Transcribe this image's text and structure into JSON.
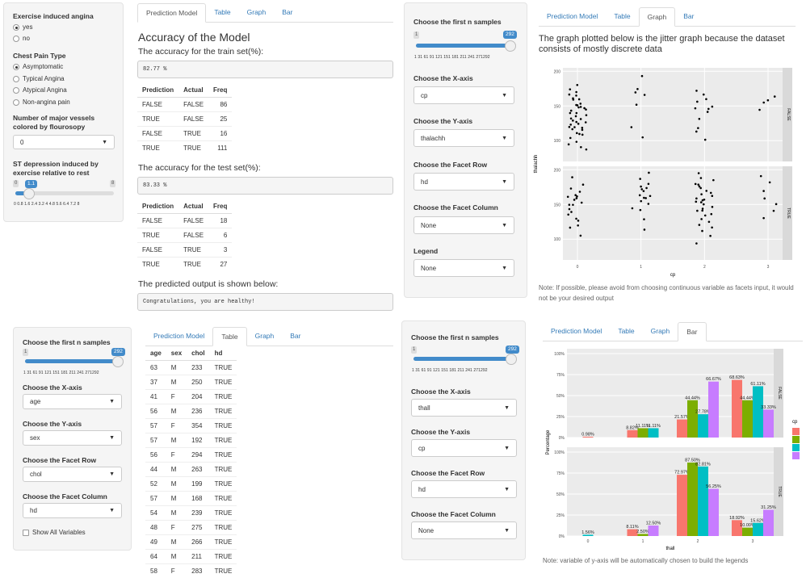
{
  "panel_a": {
    "angina": {
      "label": "Exercise induced angina",
      "options": [
        "yes",
        "no"
      ],
      "selected": "yes"
    },
    "cp": {
      "label": "Chest Pain Type",
      "options": [
        "Asymptomatic",
        "Typical Angina",
        "Atypical Angina",
        "Non-angina pain"
      ],
      "selected": "Asymptomatic"
    },
    "vessels": {
      "label": "Number of major vessels colored by flourosopy",
      "value": "0"
    },
    "st": {
      "label": "ST depression induced by exercise relative to rest",
      "min": "0",
      "max": "8",
      "value": "1.1",
      "value_num": 1.1,
      "ticks": "0  0.8  1.6  2.4  3.2   4   4.8  5.6  6.4  7.2   8"
    }
  },
  "tabs": [
    "Prediction Model",
    "Table",
    "Graph",
    "Bar"
  ],
  "prediction": {
    "title": "Accuracy of the Model",
    "train_label": "The accuracy for the train set(%):",
    "train_value": "82.77 %",
    "test_label": "The accuracy for the test set(%):",
    "test_value": "83.33 %",
    "headers": [
      "Prediction",
      "Actual",
      "Freq"
    ],
    "train_rows": [
      [
        "FALSE",
        "FALSE",
        "86"
      ],
      [
        "TRUE",
        "FALSE",
        "25"
      ],
      [
        "FALSE",
        "TRUE",
        "16"
      ],
      [
        "TRUE",
        "TRUE",
        "111"
      ]
    ],
    "test_rows": [
      [
        "FALSE",
        "FALSE",
        "18"
      ],
      [
        "TRUE",
        "FALSE",
        "6"
      ],
      [
        "FALSE",
        "TRUE",
        "3"
      ],
      [
        "TRUE",
        "TRUE",
        "27"
      ]
    ],
    "output_label": "The predicted output is shown below:",
    "output_value": "Congratulations, you are healthy!"
  },
  "controls_graph": {
    "samples_label": "Choose the first n samples",
    "samples_min": "1",
    "samples_max": "292",
    "samples_value": "292",
    "ticks": "1  31  61  91  121 151 181 211 241 271292",
    "x_label": "Choose the X-axis",
    "x_value": "cp",
    "y_label": "Choose the Y-axis",
    "y_value": "thalachh",
    "row_label": "Choose the Facet Row",
    "row_value": "hd",
    "col_label": "Choose the Facet Column",
    "col_value": "None",
    "legend_label": "Legend",
    "legend_value": "None"
  },
  "graph": {
    "title": "The graph plotted below is the jitter graph because the dataset consists of mostly discrete data",
    "note": "Note: If possible, please avoid from choosing continuous variable as facets input, it would not be your desired output",
    "chart_data": {
      "type": "scatter",
      "xlabel": "cp",
      "ylabel": "thalachh",
      "facets": [
        "FALSE",
        "TRUE"
      ],
      "x_ticks": [
        "0",
        "1",
        "2",
        "3"
      ],
      "y_ticks": [
        "100",
        "150",
        "200"
      ],
      "ylim": [
        70,
        205
      ],
      "series": [
        {
          "name": "FALSE",
          "points": [
            [
              0,
              180
            ],
            [
              0,
              175
            ],
            [
              0,
              170
            ],
            [
              0,
              165
            ],
            [
              0,
              160
            ],
            [
              0,
              158
            ],
            [
              0,
              155
            ],
            [
              0,
              152
            ],
            [
              0,
              150
            ],
            [
              0,
              148
            ],
            [
              0,
              145
            ],
            [
              0,
              143
            ],
            [
              0,
              140
            ],
            [
              0,
              138
            ],
            [
              0,
              135
            ],
            [
              0,
              132
            ],
            [
              0,
              130
            ],
            [
              0,
              128
            ],
            [
              0,
              125
            ],
            [
              0,
              122
            ],
            [
              0,
              120
            ],
            [
              0,
              118
            ],
            [
              0,
              115
            ],
            [
              0,
              112
            ],
            [
              0,
              110
            ],
            [
              0,
              108
            ],
            [
              0,
              105
            ],
            [
              0,
              100
            ],
            [
              0,
              95
            ],
            [
              0,
              90
            ],
            [
              0,
              88
            ],
            [
              0,
              165
            ],
            [
              0,
              150
            ],
            [
              0,
              140
            ],
            [
              0,
              130
            ],
            [
              0,
              120
            ],
            [
              0,
              160
            ],
            [
              0,
              145
            ],
            [
              0,
              125
            ],
            [
              0,
              115
            ],
            [
              1,
              195
            ],
            [
              1,
              175
            ],
            [
              1,
              170
            ],
            [
              1,
              165
            ],
            [
              1,
              150
            ],
            [
              1,
              120
            ],
            [
              1,
              105
            ],
            [
              2,
              170
            ],
            [
              2,
              165
            ],
            [
              2,
              160
            ],
            [
              2,
              155
            ],
            [
              2,
              150
            ],
            [
              2,
              148
            ],
            [
              2,
              145
            ],
            [
              2,
              140
            ],
            [
              2,
              130
            ],
            [
              2,
              120
            ],
            [
              2,
              115
            ],
            [
              2,
              100
            ],
            [
              3,
              165
            ],
            [
              3,
              160
            ],
            [
              3,
              155
            ],
            [
              3,
              145
            ]
          ]
        },
        {
          "name": "TRUE",
          "points": [
            [
              0,
              190
            ],
            [
              0,
              180
            ],
            [
              0,
              175
            ],
            [
              0,
              170
            ],
            [
              0,
              165
            ],
            [
              0,
              162
            ],
            [
              0,
              160
            ],
            [
              0,
              158
            ],
            [
              0,
              155
            ],
            [
              0,
              152
            ],
            [
              0,
              150
            ],
            [
              0,
              148
            ],
            [
              0,
              145
            ],
            [
              0,
              140
            ],
            [
              0,
              135
            ],
            [
              0,
              130
            ],
            [
              0,
              125
            ],
            [
              0,
              120
            ],
            [
              0,
              115
            ],
            [
              0,
              105
            ],
            [
              1,
              195
            ],
            [
              1,
              185
            ],
            [
              1,
              180
            ],
            [
              1,
              175
            ],
            [
              1,
              172
            ],
            [
              1,
              170
            ],
            [
              1,
              168
            ],
            [
              1,
              165
            ],
            [
              1,
              162
            ],
            [
              1,
              160
            ],
            [
              1,
              158
            ],
            [
              1,
              155
            ],
            [
              1,
              150
            ],
            [
              1,
              145
            ],
            [
              1,
              140
            ],
            [
              1,
              130
            ],
            [
              1,
              115
            ],
            [
              2,
              195
            ],
            [
              2,
              190
            ],
            [
              2,
              185
            ],
            [
              2,
              180
            ],
            [
              2,
              178
            ],
            [
              2,
              175
            ],
            [
              2,
              172
            ],
            [
              2,
              170
            ],
            [
              2,
              168
            ],
            [
              2,
              165
            ],
            [
              2,
              162
            ],
            [
              2,
              160
            ],
            [
              2,
              158
            ],
            [
              2,
              156
            ],
            [
              2,
              155
            ],
            [
              2,
              153
            ],
            [
              2,
              150
            ],
            [
              2,
              148
            ],
            [
              2,
              145
            ],
            [
              2,
              143
            ],
            [
              2,
              140
            ],
            [
              2,
              138
            ],
            [
              2,
              135
            ],
            [
              2,
              130
            ],
            [
              2,
              125
            ],
            [
              2,
              120
            ],
            [
              2,
              115
            ],
            [
              2,
              110
            ],
            [
              2,
              105
            ],
            [
              2,
              95
            ],
            [
              3,
              190
            ],
            [
              3,
              180
            ],
            [
              3,
              170
            ],
            [
              3,
              160
            ],
            [
              3,
              150
            ],
            [
              3,
              140
            ],
            [
              3,
              130
            ]
          ]
        }
      ]
    }
  },
  "controls_table": {
    "samples_label": "Choose the first n samples",
    "samples_value": "292",
    "samples_min": "1",
    "ticks": "1  31  61  91  121 151 181 211 241 271292",
    "x_label": "Choose the X-axis",
    "x_value": "age",
    "y_label": "Choose the Y-axis",
    "y_value": "sex",
    "row_label": "Choose the Facet Row",
    "row_value": "chol",
    "col_label": "Choose the Facet Column",
    "col_value": "hd",
    "checkbox_label": "Show All Variables"
  },
  "table": {
    "headers": [
      "age",
      "sex",
      "chol",
      "hd"
    ],
    "rows": [
      [
        "63",
        "M",
        "233",
        "TRUE"
      ],
      [
        "37",
        "M",
        "250",
        "TRUE"
      ],
      [
        "41",
        "F",
        "204",
        "TRUE"
      ],
      [
        "56",
        "M",
        "236",
        "TRUE"
      ],
      [
        "57",
        "F",
        "354",
        "TRUE"
      ],
      [
        "57",
        "M",
        "192",
        "TRUE"
      ],
      [
        "56",
        "F",
        "294",
        "TRUE"
      ],
      [
        "44",
        "M",
        "263",
        "TRUE"
      ],
      [
        "52",
        "M",
        "199",
        "TRUE"
      ],
      [
        "57",
        "M",
        "168",
        "TRUE"
      ],
      [
        "54",
        "M",
        "239",
        "TRUE"
      ],
      [
        "48",
        "F",
        "275",
        "TRUE"
      ],
      [
        "49",
        "M",
        "266",
        "TRUE"
      ],
      [
        "64",
        "M",
        "211",
        "TRUE"
      ],
      [
        "58",
        "F",
        "283",
        "TRUE"
      ]
    ]
  },
  "controls_bar": {
    "samples_label": "Choose the first n samples",
    "samples_value": "292",
    "samples_min": "1",
    "ticks": "1  31  61  91  121 151 181 211 241 271292",
    "x_label": "Choose the X-axis",
    "x_value": "thall",
    "y_label": "Choose the Y-axis",
    "y_value": "cp",
    "row_label": "Choose the Facet Row",
    "row_value": "hd",
    "col_label": "Choose the Facet Column",
    "col_value": "None"
  },
  "bar": {
    "note": "Note: variable of y-axis will be automatically chosen to build the legends",
    "chart_data": {
      "type": "bar",
      "xlabel": "thall",
      "ylabel": "Percentage",
      "legend_title": "cp",
      "categories": [
        "0",
        "1",
        "2",
        "3"
      ],
      "y_ticks": [
        "0%",
        "25%",
        "50%",
        "75%",
        "100%"
      ],
      "ylim": [
        0,
        100
      ],
      "colors": [
        "#f8766d",
        "#7cae00",
        "#00bfc4",
        "#c77cff"
      ],
      "facets": [
        {
          "name": "FALSE",
          "bars": [
            [
              0.98,
              null,
              null,
              null
            ],
            [
              8.82,
              11.11,
              11.11,
              null
            ],
            [
              21.57,
              44.44,
              27.78,
              66.67
            ],
            [
              68.63,
              44.44,
              61.11,
              33.33
            ]
          ],
          "labels": [
            [
              "0.98%",
              "",
              "",
              ""
            ],
            [
              "8.82%",
              "11.11%",
              "11.11%",
              ""
            ],
            [
              "21.57%",
              "44.44%",
              "27.78%",
              "66.67%"
            ],
            [
              "68.63%",
              "44.44%",
              "61.11%",
              "33.33%"
            ]
          ]
        },
        {
          "name": "TRUE",
          "bars": [
            [
              null,
              null,
              1.56,
              null
            ],
            [
              8.11,
              2.5,
              null,
              12.5
            ],
            [
              72.97,
              87.5,
              82.81,
              56.25
            ],
            [
              18.92,
              10,
              15.62,
              31.25
            ]
          ],
          "labels": [
            [
              "",
              "",
              "1.56%",
              ""
            ],
            [
              "8.11%",
              "2.50%",
              "",
              "12.50%"
            ],
            [
              "72.97%",
              "87.50%",
              "82.81%",
              "56.25%"
            ],
            [
              "18.92%",
              "10.00%",
              "15.62%",
              "31.25%"
            ]
          ]
        }
      ]
    }
  }
}
